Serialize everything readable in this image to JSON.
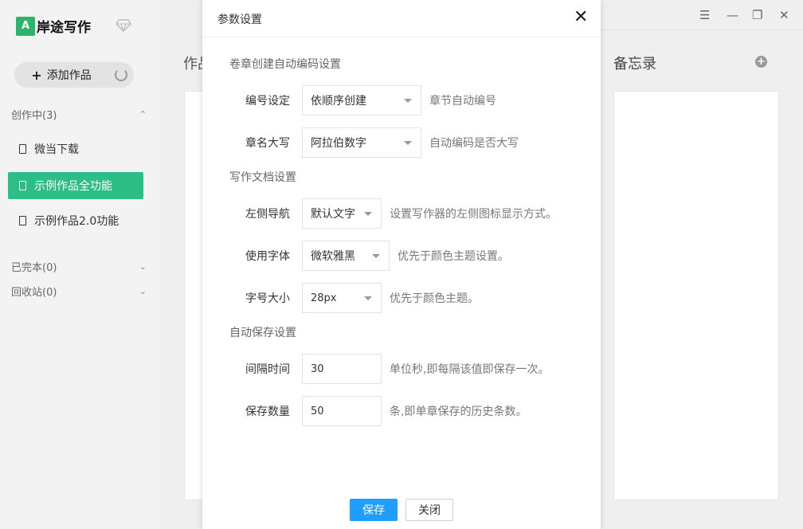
{
  "app": {
    "logo_mark": "A",
    "name": "岸途写作"
  },
  "sidebar": {
    "add_label": "添加作品",
    "groups": [
      {
        "label": "创作中",
        "count": "(3)"
      },
      {
        "label": "已完本",
        "count": "(0)"
      },
      {
        "label": "回收站",
        "count": "(0)"
      }
    ],
    "items": [
      {
        "label": "微当下载"
      },
      {
        "label": "示例作品全功能"
      },
      {
        "label": "示例作品2.0功能"
      }
    ]
  },
  "main": {
    "works_heading": "作品",
    "memo_heading": "备忘录"
  },
  "dialog": {
    "title": "参数设置",
    "sections": [
      {
        "title": "卷章创建自动编码设置"
      },
      {
        "title": "写作文档设置"
      },
      {
        "title": "自动保存设置"
      }
    ],
    "rows": [
      {
        "label": "编号设定",
        "value": "依顺序创建",
        "hint": "章节自动编号"
      },
      {
        "label": "章名大写",
        "value": "阿拉伯数字",
        "hint": "自动编码是否大写"
      },
      {
        "label": "左侧导航",
        "value": "默认文字",
        "hint": "设置写作器的左侧图标显示方式。"
      },
      {
        "label": "使用字体",
        "value": "微软雅黑",
        "hint": "优先于颜色主题设置。"
      },
      {
        "label": "字号大小",
        "value": "28px",
        "hint": "优先于颜色主题。"
      },
      {
        "label": "间隔时间",
        "value": "30",
        "hint": "单位秒,即每隔该值即保存一次。"
      },
      {
        "label": "保存数量",
        "value": "50",
        "hint": "条,即单章保存的历史条数。"
      }
    ],
    "save_label": "保存",
    "close_label": "关闭"
  },
  "colors": {
    "brand": "#2ab56a",
    "active_item": "#2dbd86",
    "primary_button": "#1e9fff"
  },
  "icons": [
    "diamond-icon",
    "loading-icon",
    "doc-icon",
    "chevron-up-icon",
    "chevron-down-icon",
    "plus-circle-icon",
    "menu-icon",
    "minimize-icon",
    "restore-icon",
    "close-icon"
  ]
}
